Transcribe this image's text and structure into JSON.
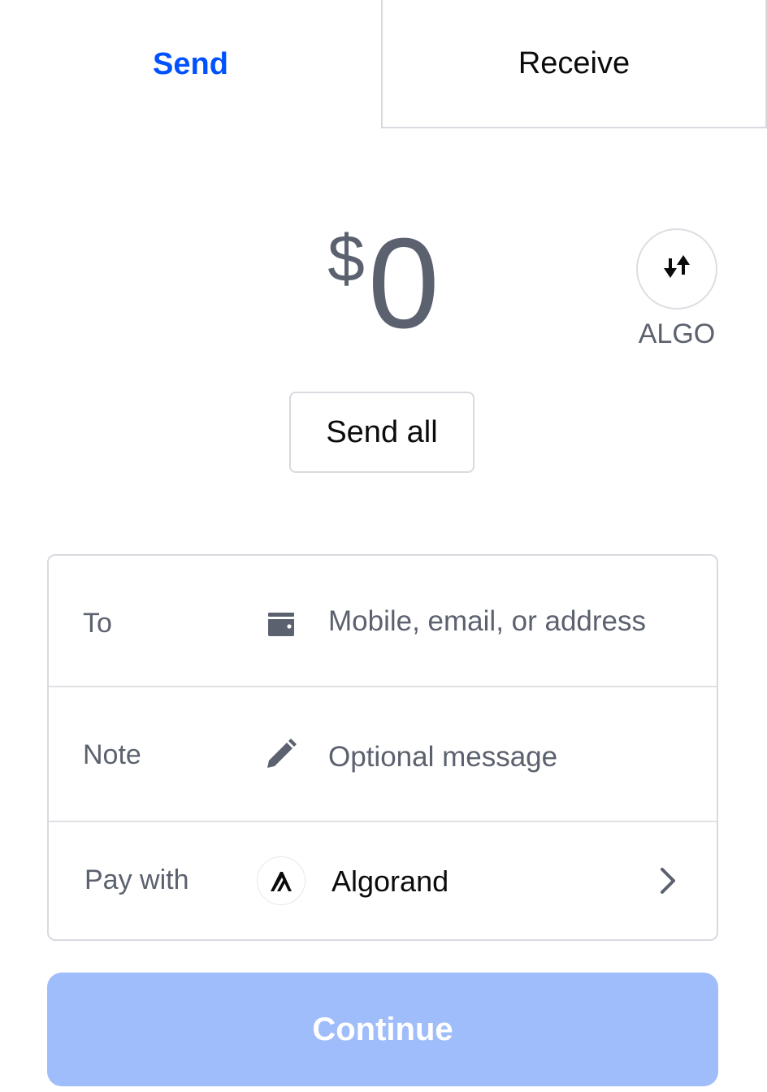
{
  "tabs": {
    "send": "Send",
    "receive": "Receive"
  },
  "amount": {
    "currency_symbol": "$",
    "value": "0"
  },
  "unit_toggle": {
    "icon": "swap-vertical-arrows-icon",
    "label": "ALGO"
  },
  "send_all": {
    "label": "Send all"
  },
  "form": {
    "to": {
      "label": "To",
      "icon": "wallet-icon",
      "placeholder": "Mobile, email, or address"
    },
    "note": {
      "label": "Note",
      "icon": "pencil-icon",
      "placeholder": "Optional message"
    },
    "pay_with": {
      "label": "Pay with",
      "icon": "algorand-logo-icon",
      "asset": "Algorand",
      "chevron": "chevron-right-icon"
    }
  },
  "continue_button": {
    "label": "Continue"
  },
  "colors": {
    "accent": "#0052ff",
    "muted_text": "#5b616e",
    "border": "#d8dadf",
    "continue_disabled": "#a0bdfb"
  }
}
